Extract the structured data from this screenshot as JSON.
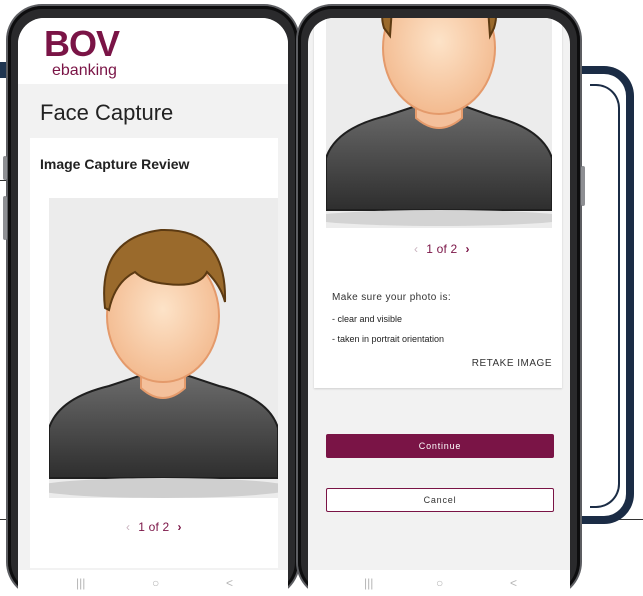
{
  "brand": {
    "logo_main": "BOV",
    "logo_sub": "ebanking",
    "color": "#7a1446"
  },
  "left_screen": {
    "page_title": "Face Capture",
    "card_title": "Image Capture Review",
    "pager": {
      "text": "1 of 2",
      "prev_icon": "chevron-left-icon",
      "next_icon": "chevron-right-icon"
    }
  },
  "right_screen": {
    "pager": {
      "text": "1 of 2"
    },
    "hint_intro": "Make sure your photo is:",
    "hints": [
      "- clear and visible",
      "- taken in portrait orientation"
    ],
    "retake_label": "RETAKE IMAGE",
    "continue_label": "Continue",
    "cancel_label": "Cancel"
  },
  "nav_bar": {
    "recent_icon": "|||",
    "home_icon": "○",
    "back_icon": "<"
  },
  "icons": {
    "prev": "‹",
    "next": "›"
  }
}
